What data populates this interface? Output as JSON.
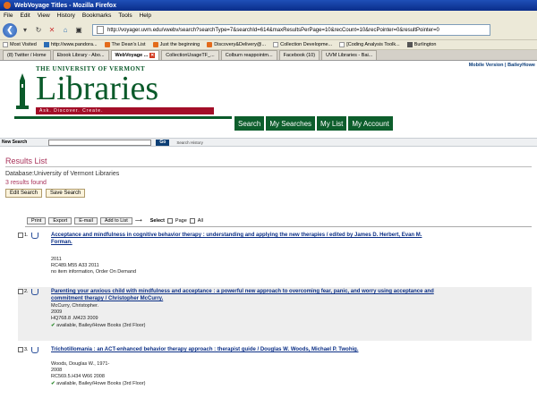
{
  "window": {
    "title": "WebVoyage Titles - Mozilla Firefox"
  },
  "menu": [
    "File",
    "Edit",
    "View",
    "History",
    "Bookmarks",
    "Tools",
    "Help"
  ],
  "nav": {
    "url": "http://voyager.uvm.edu/vwebv/search?searchType=7&searchId=614&maxResultsPerPage=10&recCount=10&recPointer=0&resultPointer=0"
  },
  "bookmarks": [
    "Most Visited",
    "http://www.pandora...",
    "The Dean's List",
    "Just the beginning",
    "Discovery&Delivery@...",
    "Collection Developme...",
    "[Coding Analysis Toolk...",
    "Burlington"
  ],
  "tabs": [
    {
      "label": "(8) Twitter / Home"
    },
    {
      "label": "Ebook Library - Abo..."
    },
    {
      "label": "WebVoyage ..."
    },
    {
      "label": "CollectionUsageTF_..."
    },
    {
      "label": "Colburn reappointm..."
    },
    {
      "label": "Facebook (10)"
    },
    {
      "label": "UVM Libraries - Bai..."
    }
  ],
  "header": {
    "university": "THE UNIVERSITY OF VERMONT",
    "libraries": "Libraries",
    "tagline": "Ask. Discover. Create.",
    "mobile_links": "Mobile Version | BaileyHowe",
    "nav_tabs": [
      "Search",
      "My Searches",
      "My List",
      "My Account"
    ]
  },
  "search": {
    "label": "New Search",
    "go": "Go",
    "history": "Search History"
  },
  "results": {
    "title": "Results List",
    "database": "Database:University of Vermont Libraries",
    "found": "3 results found",
    "edit": "Edit Search",
    "save": "Save Search"
  },
  "toolbar": {
    "buttons": [
      "Print",
      "Export",
      "E-mail",
      "Add to List"
    ],
    "select": "Select",
    "page": "Page",
    "all": "All"
  },
  "records": [
    {
      "num": "1.",
      "title": "Acceptance and mindfulness in cognitive behavior therapy : understanding and applying the new therapies / edited by James D. Herbert, Evan M. Forman.",
      "author": "",
      "year": "2011",
      "call": "RC489.M55 A33 2011",
      "status": "no item information, Order On Demand",
      "available": false
    },
    {
      "num": "2.",
      "title": "Parenting your anxious child with mindfulness and acceptance : a powerful new approach to overcoming fear, panic, and worry using acceptance and commitment therapy / Christopher McCurry.",
      "author": "McCurry, Christopher.",
      "year": "2009",
      "call": "HQ768.8 .M423 2009",
      "status": "available, Bailey/Howe Books (3rd Floor)",
      "available": true
    },
    {
      "num": "3.",
      "title": "Trichotillomania : an ACT-enhanced behavior therapy approach : therapist guide / Douglas W. Woods, Michael P. Twohig.",
      "author": "Woods, Douglas W., 1971-",
      "year": "2008",
      "call": "RC569.5.H34 W66 2008",
      "status": "available, Bailey/Howe Books (3rd Floor)",
      "available": true
    }
  ]
}
